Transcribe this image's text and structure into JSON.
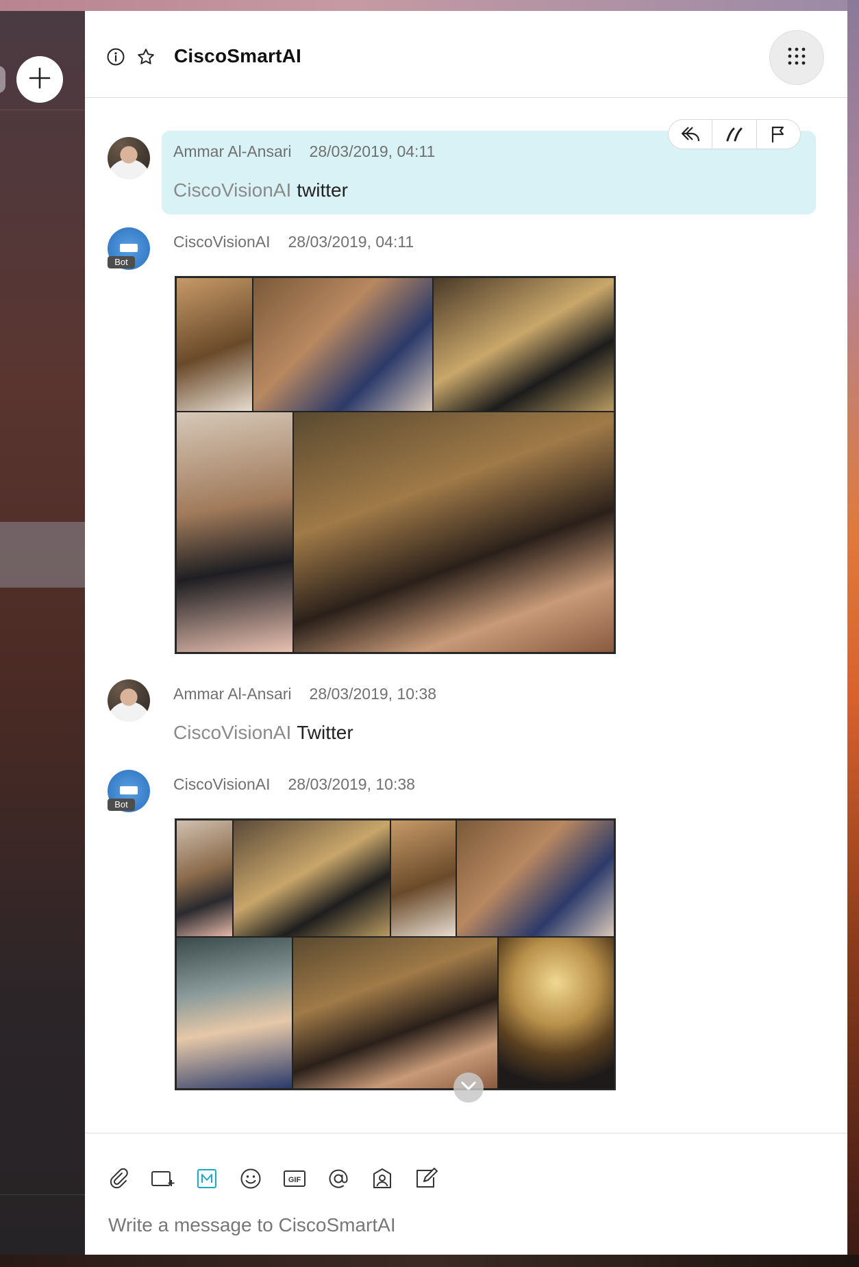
{
  "conversation": {
    "title": "CiscoSmartAI"
  },
  "messages": [
    {
      "sender": "Ammar Al-Ansari",
      "timestamp": "28/03/2019, 04:11",
      "mention": "CiscoVisionAI",
      "text": "twitter",
      "highlighted": true
    },
    {
      "sender": "CiscoVisionAI",
      "timestamp": "28/03/2019, 04:11",
      "badge": "Bot",
      "attachment": "photo-collage"
    },
    {
      "sender": "Ammar Al-Ansari",
      "timestamp": "28/03/2019, 10:38",
      "mention": "CiscoVisionAI",
      "text": "Twitter"
    },
    {
      "sender": "CiscoVisionAI",
      "timestamp": "28/03/2019, 10:38",
      "badge": "Bot",
      "attachment": "photo-collage"
    }
  ],
  "message_actions": [
    "reply-icon",
    "quote-icon",
    "flag-icon"
  ],
  "composer": {
    "placeholder": "Write a message to CiscoSmartAI",
    "tools": [
      "attach-icon",
      "screen-capture-icon",
      "markdown-icon",
      "emoji-icon",
      "gif-icon",
      "mention-icon",
      "contact-icon",
      "whiteboard-icon"
    ]
  },
  "colors": {
    "accent": "#1aa8c8",
    "highlight_bg": "#d9f2f6",
    "bot_avatar": "#2a6fc0"
  }
}
